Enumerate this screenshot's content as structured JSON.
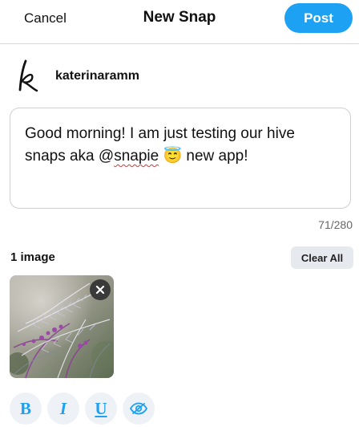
{
  "header": {
    "cancel_label": "Cancel",
    "title": "New Snap",
    "post_label": "Post"
  },
  "author": {
    "avatar_letter": "k",
    "username": "katerinaramm"
  },
  "composer": {
    "text_before_mention": "Good morning! I am just testing our hive snaps aka @",
    "mention": "snapie",
    "emoji": "😇",
    "text_after": " new app!",
    "char_count": "71/280"
  },
  "images": {
    "count_label": "1 image",
    "clear_all_label": "Clear All",
    "remove_icon": "close-icon"
  },
  "toolbar": {
    "bold_label": "B",
    "italic_label": "I",
    "underline_label": "U",
    "preview_icon": "eye-slash-icon"
  },
  "colors": {
    "accent": "#1da1f2",
    "clear_bg": "#e6e9ee"
  }
}
